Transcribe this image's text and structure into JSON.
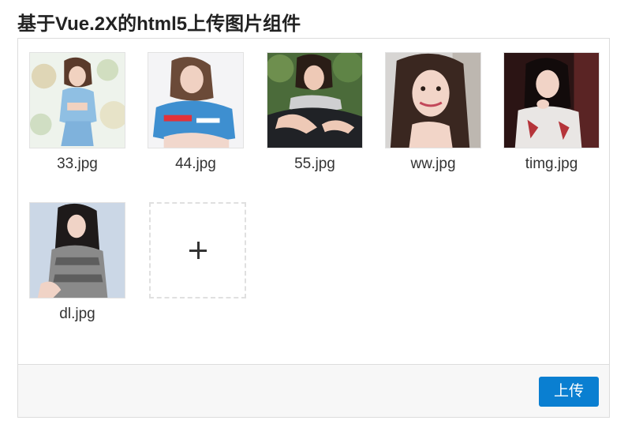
{
  "page": {
    "title": "基于Vue.2X的html5上传图片组件"
  },
  "uploader": {
    "files": [
      {
        "name": "33.jpg"
      },
      {
        "name": "44.jpg"
      },
      {
        "name": "55.jpg"
      },
      {
        "name": "ww.jpg"
      },
      {
        "name": "timg.jpg"
      },
      {
        "name": "dl.jpg"
      }
    ],
    "add_icon": "plus-icon",
    "upload_label": "上传"
  },
  "colors": {
    "accent": "#0a7fd1",
    "footer_bg": "#f7f7f7",
    "border": "#dcdcdc"
  }
}
